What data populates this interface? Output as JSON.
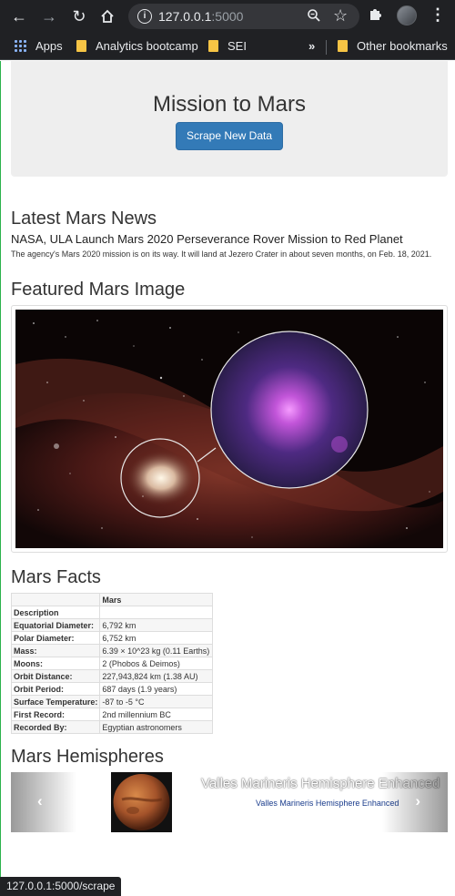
{
  "browser": {
    "url_host": "127.0.0.1",
    "url_port": ":5000",
    "bookmarks": {
      "apps": "Apps",
      "items": [
        "Analytics bootcamp",
        "SEI"
      ],
      "overflow": "»",
      "other": "Other bookmarks"
    },
    "status_text": "127.0.0.1:5000/scrape"
  },
  "jumbotron": {
    "title": "Mission to Mars",
    "button_label": "Scrape New Data"
  },
  "news": {
    "heading": "Latest Mars News",
    "title": "NASA, ULA Launch Mars 2020 Perseverance Rover Mission to Red Planet",
    "teaser": "The agency's Mars 2020 mission is on its way. It will land at Jezero Crater in about seven months, on Feb. 18, 2021."
  },
  "featured_image": {
    "heading": "Featured Mars Image"
  },
  "facts": {
    "heading": "Mars Facts",
    "column_header": "Mars",
    "index_label": "Description",
    "rows": [
      [
        "Equatorial Diameter:",
        "6,792 km"
      ],
      [
        "Polar Diameter:",
        "6,752 km"
      ],
      [
        "Mass:",
        "6.39 × 10^23 kg (0.11 Earths)"
      ],
      [
        "Moons:",
        "2 (Phobos & Deimos)"
      ],
      [
        "Orbit Distance:",
        "227,943,824 km (1.38 AU)"
      ],
      [
        "Orbit Period:",
        "687 days (1.9 years)"
      ],
      [
        "Surface Temperature:",
        "-87 to -5 °C"
      ],
      [
        "First Record:",
        "2nd millennium BC"
      ],
      [
        "Recorded By:",
        "Egyptian astronomers"
      ]
    ]
  },
  "hemispheres": {
    "heading": "Mars Hemispheres",
    "caption": "Valles Marineris Hemisphere Enhanced",
    "link_text": "Valles Marineris Hemisphere Enhanced"
  }
}
